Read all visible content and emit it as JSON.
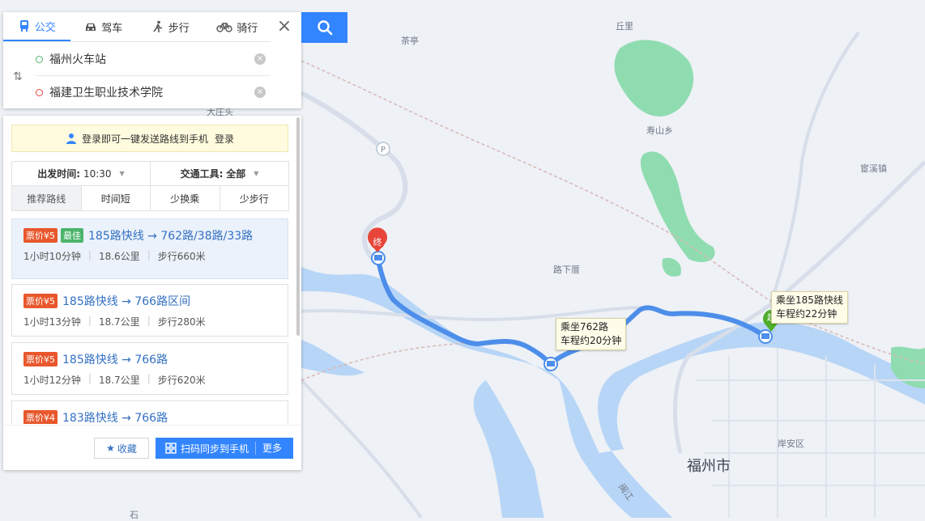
{
  "modes": [
    {
      "label": "公交",
      "icon": "bus-icon",
      "active": true
    },
    {
      "label": "驾车",
      "icon": "car-icon",
      "active": false
    },
    {
      "label": "步行",
      "icon": "walk-icon",
      "active": false
    },
    {
      "label": "骑行",
      "icon": "bike-icon",
      "active": false
    }
  ],
  "start": {
    "value": "福州火车站"
  },
  "end": {
    "value": "福建卫生职业技术学院"
  },
  "login": {
    "text": "登录即可一键发送路线到手机",
    "link": "登录"
  },
  "options": {
    "depart_label": "出发时间:",
    "depart_value": "10:30",
    "transport_label": "交通工具:",
    "transport_value": "全部",
    "sort": [
      "推荐路线",
      "时间短",
      "少换乘",
      "少步行"
    ]
  },
  "routes": [
    {
      "fare": "票价¥5",
      "best": "最佳",
      "name": "185路快线 → 762路/38路/33路",
      "time": "1小时10分钟",
      "distance": "18.6公里",
      "walk": "步行660米"
    },
    {
      "fare": "票价¥5",
      "best": "",
      "name": "185路快线 → 766路区间",
      "time": "1小时13分钟",
      "distance": "18.7公里",
      "walk": "步行280米"
    },
    {
      "fare": "票价¥5",
      "best": "",
      "name": "185路快线 → 766路",
      "time": "1小时12分钟",
      "distance": "18.7公里",
      "walk": "步行620米"
    },
    {
      "fare": "票价¥4",
      "best": "",
      "name": "183路快线 → 766路",
      "time": "",
      "distance": "",
      "walk": ""
    }
  ],
  "actions": {
    "favorite": "收藏",
    "sync": "扫码同步到手机",
    "more": "更多"
  },
  "map": {
    "labels": {
      "chating": "茶亭",
      "qiuli": "丘里",
      "shoushan": "寿山乡",
      "guanxi": "宦溪镇",
      "luxiacuo": "路下厝",
      "yanan": "岸安区",
      "city": "福州市",
      "dazhuang": "大庄头",
      "shi": "石",
      "minjiang": "闽江"
    },
    "tip_start": {
      "line1": "乘坐185路快线",
      "line2": "车程约22分钟"
    },
    "tip_transfer": {
      "line1": "乘坐762路",
      "line2": "车程约20分钟"
    },
    "end_marker": "终",
    "start_marker": "起",
    "p_marker": "P"
  },
  "colors": {
    "accent": "#3385ff",
    "route": "#4d8eea",
    "fare": "#e8572c",
    "best": "#4cb56b",
    "green_area": "#8fdcb0"
  }
}
